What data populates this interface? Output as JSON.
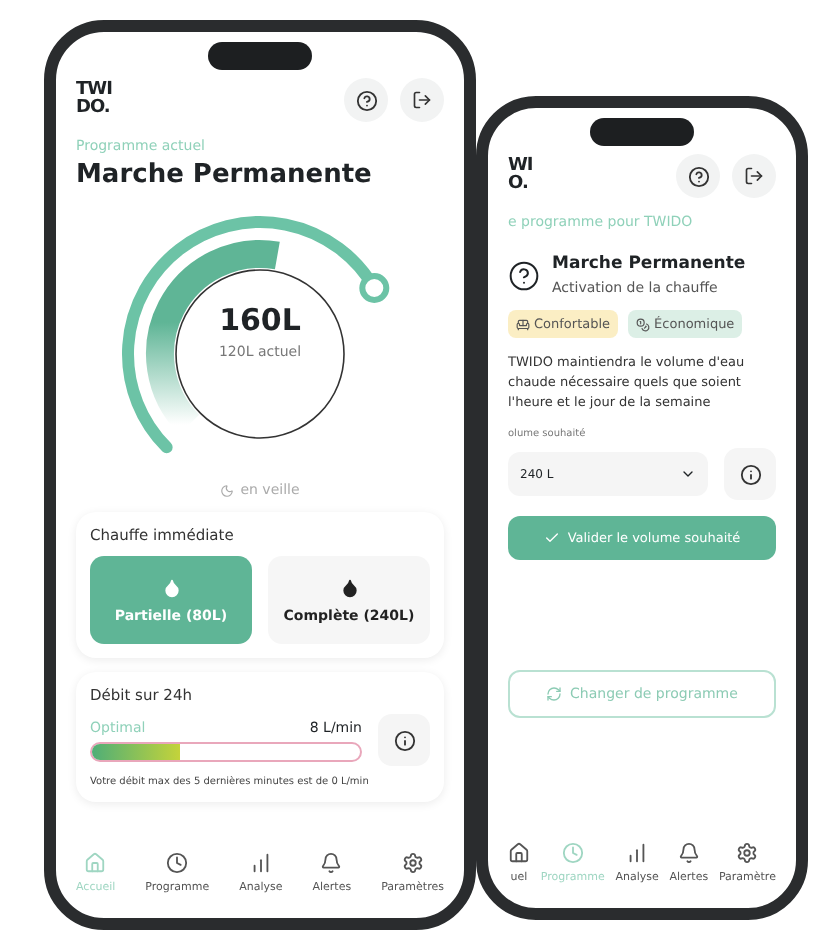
{
  "front_phone": {
    "logo": [
      "TWI",
      "DO."
    ],
    "subtitle": "Programme actuel",
    "title": "Marche Permanente",
    "gauge": {
      "value": "160L",
      "current": "120L actuel"
    },
    "status": "en veille",
    "heating": {
      "title": "Chauffe immédiate",
      "options": [
        {
          "label": "Partielle (80L)",
          "kind": "partial",
          "selected": true
        },
        {
          "label": "Complète (240L)",
          "kind": "full",
          "selected": false
        }
      ]
    },
    "flow": {
      "title": "Débit sur 24h",
      "state": "Optimal",
      "reading": "8 L/min",
      "level": 0.33,
      "note": "Votre débit max des 5 dernières minutes est de 0 L/min"
    },
    "nav": [
      {
        "label": "Accueil",
        "kind": "home",
        "selected": true
      },
      {
        "label": "Programme",
        "kind": "clock",
        "selected": false
      },
      {
        "label": "Analyse",
        "kind": "chart",
        "selected": false
      },
      {
        "label": "Alertes",
        "kind": "bell",
        "selected": false
      },
      {
        "label": "Paramètres",
        "kind": "gear",
        "selected": false
      }
    ]
  },
  "back_phone": {
    "logo": [
      "WI",
      "O."
    ],
    "subtitle": "e programme pour TWIDO",
    "title": "Marche Permanente",
    "caption": "Activation de la chauffe",
    "tags": [
      {
        "label": "Confortable",
        "kind": "sofa",
        "color": "#fbeec4"
      },
      {
        "label": "Économique",
        "kind": "coin",
        "color": "#dcefe6"
      }
    ],
    "description": "TWIDO maintiendra le volume d'eau chaude nécessaire quels que soient l'heure et le jour de la semaine",
    "volume_label": "olume souhaité",
    "volume_value": "240 L",
    "confirm": "Valider le volume souhaité",
    "change": "Changer de programme",
    "nav": [
      {
        "label": "uel",
        "kind": "home",
        "selected": false
      },
      {
        "label": "Programme",
        "kind": "clock",
        "selected": true
      },
      {
        "label": "Analyse",
        "kind": "chart",
        "selected": false
      },
      {
        "label": "Alertes",
        "kind": "bell",
        "selected": false
      },
      {
        "label": "Paramètre",
        "kind": "gear",
        "selected": false
      }
    ]
  }
}
